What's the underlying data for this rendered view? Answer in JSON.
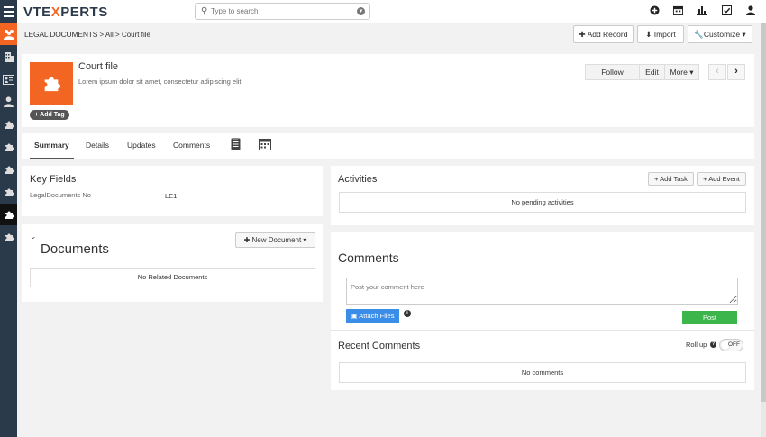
{
  "header": {
    "logo_prefix": "VTE",
    "logo_x": "X",
    "logo_suffix": "PERTS",
    "search_placeholder": "Type to search"
  },
  "top_icons": [
    "plus-circle-icon",
    "calendar-icon",
    "bar-chart-icon",
    "checkbox-icon",
    "user-icon"
  ],
  "sidebar": {
    "items": [
      "users-icon",
      "building-icon",
      "address-card-icon",
      "user-icon",
      "puzzle-icon",
      "puzzle-icon",
      "puzzle-icon",
      "puzzle-icon",
      "puzzle-icon",
      "puzzle-icon"
    ]
  },
  "breadcrumb": {
    "module": "LEGAL DOCUMENTS",
    "sep1": ">",
    "all": "All",
    "sep2": ">",
    "current": "Court file"
  },
  "actions": {
    "add_record": "Add Record",
    "import": "Import",
    "customize": "Customize"
  },
  "record": {
    "title": "Court file",
    "description": "Lorem ipsum dolor sit amet, consectetur adipiscing elit",
    "add_tag": "Add Tag",
    "follow": "Follow",
    "edit": "Edit",
    "more": "More"
  },
  "tabs": [
    "Summary",
    "Details",
    "Updates",
    "Comments"
  ],
  "key_fields": {
    "title": "Key Fields",
    "label": "LegalDocuments No",
    "value": "LE1"
  },
  "documents": {
    "title": "Documents",
    "new_button": "New Document",
    "empty": "No Related Documents"
  },
  "activities": {
    "title": "Activities",
    "add_task": "Add Task",
    "add_event": "Add Event",
    "empty": "No pending activities"
  },
  "comments": {
    "title": "Comments",
    "placeholder": "Post your comment here",
    "attach": "Attach Files",
    "post": "Post",
    "recent_title": "Recent Comments",
    "roll_up": "Roll up",
    "toggle": "OFF",
    "empty": "No comments"
  },
  "colors": {
    "brand_orange": "#f26522",
    "sidebar": "#2b3a4a",
    "post_green": "#3cb54a",
    "attach_blue": "#3b8ee8"
  }
}
